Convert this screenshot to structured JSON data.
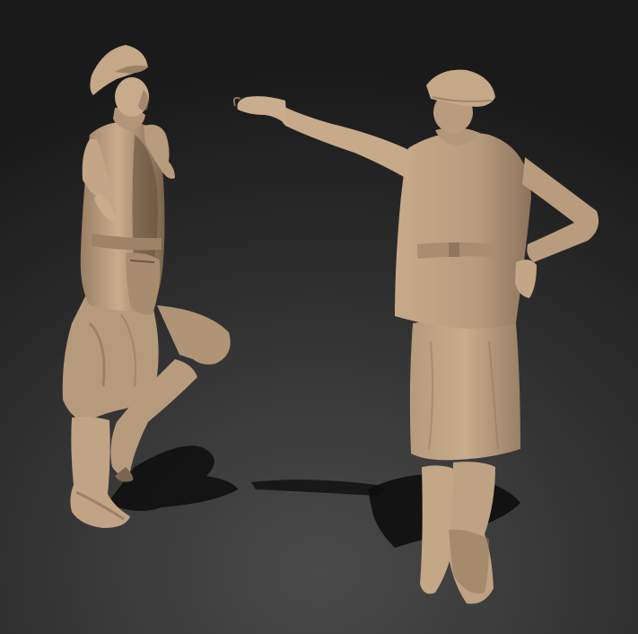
{
  "scene": {
    "figures": [
      {
        "id": "soldier-man",
        "role": "left figure dancing, arms outstretched, one leg raised"
      },
      {
        "id": "soldier-woman",
        "role": "right figure, arm extended pointing, hand on hip"
      }
    ],
    "colors": {
      "background_center": "#4a4a4a",
      "background_edge": "#1a1a1a",
      "clay_light": "#c9ad8c",
      "clay_mid": "#b2967a",
      "clay_dark": "#8a7058",
      "clay_shadow": "#5e4a39",
      "floor_shadow": "#0f0f0f"
    }
  }
}
